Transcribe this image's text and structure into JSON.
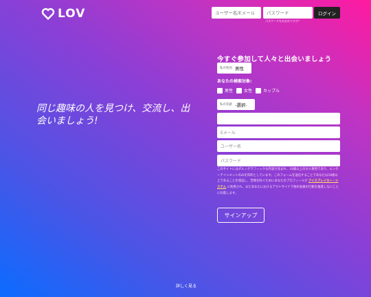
{
  "header": {
    "logo_text": "LOV",
    "username_placeholder": "ユーザー名/Eメール",
    "password_placeholder": "パスワード",
    "login_label": "ログイン",
    "forgot_password": "パスワードをお忘れですか？"
  },
  "hero": {
    "tagline": "同じ趣味の人を見つけ、交流し、出会いましょう!"
  },
  "signup_form": {
    "title": "今すぐ参加して人々と出会いましょう",
    "gender_label": "私の性別",
    "gender_value": "男性",
    "seeking_label": "あなたの検索対象:",
    "seeking_options": [
      "男性",
      "女性",
      "カップル"
    ],
    "age_label": "私の年齢",
    "age_value": "-選択-",
    "email_placeholder": "Eメール",
    "username_placeholder": "ユーザー名",
    "password_placeholder": "パスワード",
    "disclaimer_text": "このサイトにはポルノグラフィックな内容が含まれ、18歳以上の大人専用であり、エンターテインメントのみを目的としています。このフォームを送信することであなたは18歳以上であることを保証し、苦情を防ぐためにあなたのプロフィールが",
    "disclaimer_link": "アイスブレイカー・システム",
    "disclaimer_tail": "に利用され、またあなたにおけるアウトサイドで他の会員の行動を推進しないことに同意します。",
    "signup_label": "サインアップ"
  },
  "footer": {
    "more_label": "詳しく見る"
  }
}
